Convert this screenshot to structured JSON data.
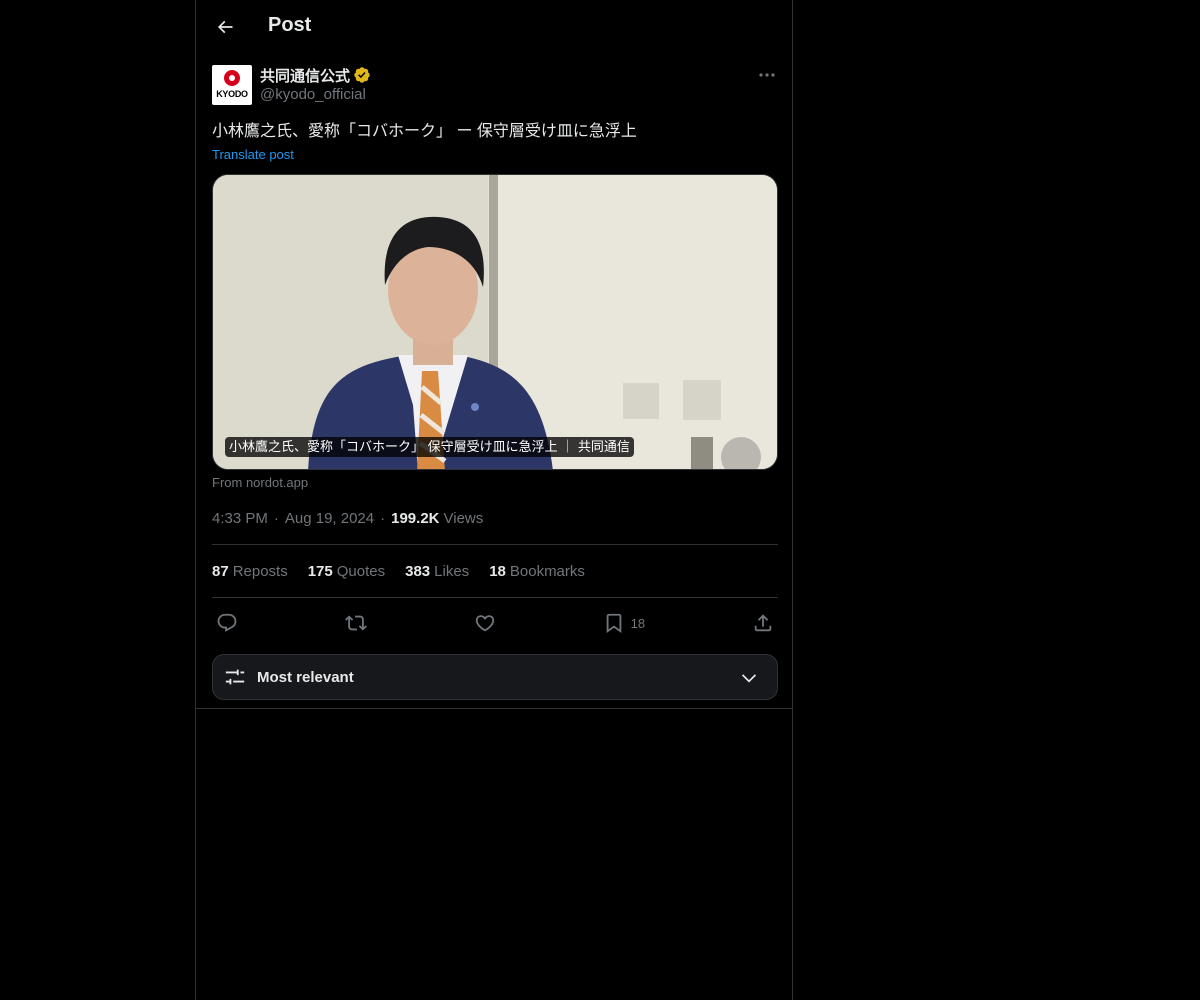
{
  "header": {
    "title": "Post"
  },
  "author": {
    "display_name": "共同通信公式",
    "handle": "@kyodo_official",
    "avatar_text": "KYODO",
    "verified_color": "#e2b719"
  },
  "post": {
    "text": "小林鷹之氏、愛称「コバホーク」 ー 保守層受け皿に急浮上",
    "translate_label": "Translate post",
    "card_caption": "小林鷹之氏、愛称「コバホーク」 保守層受け皿に急浮上 ｜ 共同通信",
    "card_source": "From nordot.app",
    "time": "4:33 PM",
    "date": "Aug 19, 2024",
    "views_count": "199.2K",
    "views_label": "Views"
  },
  "stats": {
    "reposts_count": "87",
    "reposts_label": "Reposts",
    "quotes_count": "175",
    "quotes_label": "Quotes",
    "likes_count": "383",
    "likes_label": "Likes",
    "bookmarks_count": "18",
    "bookmarks_label": "Bookmarks"
  },
  "actions": {
    "reply_icon": "reply-icon",
    "repost_icon": "repost-icon",
    "like_icon": "heart-icon",
    "bookmark_icon": "bookmark-icon",
    "bookmark_count": "18",
    "share_icon": "share-icon"
  },
  "sort": {
    "label": "Most relevant"
  },
  "colors": {
    "background": "#000000",
    "text": "#e7e9ea",
    "secondary": "#71767b",
    "accent": "#1d9bf0",
    "border": "#2f3336"
  }
}
